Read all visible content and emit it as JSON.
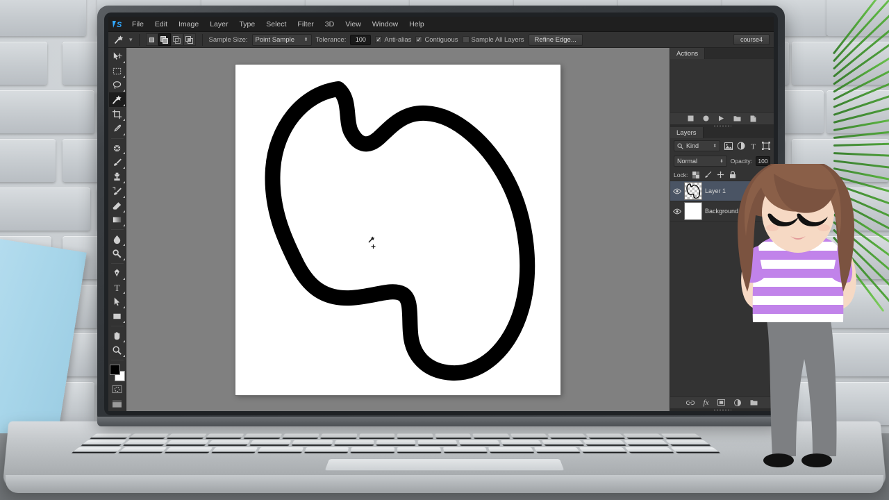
{
  "app": {
    "name": "Adobe Photoshop",
    "logo_text": "PS",
    "logo_color": "#31a8ff"
  },
  "menubar": {
    "items": [
      {
        "label": "File"
      },
      {
        "label": "Edit"
      },
      {
        "label": "Image"
      },
      {
        "label": "Layer"
      },
      {
        "label": "Type"
      },
      {
        "label": "Select"
      },
      {
        "label": "Filter"
      },
      {
        "label": "3D"
      },
      {
        "label": "View"
      },
      {
        "label": "Window"
      },
      {
        "label": "Help"
      }
    ]
  },
  "options_bar": {
    "active_tool": "magic-wand-tool",
    "selection_modes": [
      {
        "name": "new-selection",
        "active": false
      },
      {
        "name": "add-to-selection",
        "active": true
      },
      {
        "name": "subtract-from-selection",
        "active": false
      },
      {
        "name": "intersect-with-selection",
        "active": false
      }
    ],
    "sample_size_label": "Sample Size:",
    "sample_size_value": "Point Sample",
    "tolerance_label": "Tolerance:",
    "tolerance_value": "100",
    "anti_alias_label": "Anti-alias",
    "anti_alias_checked": true,
    "contiguous_label": "Contiguous",
    "contiguous_checked": true,
    "sample_all_layers_label": "Sample All Layers",
    "sample_all_layers_checked": false,
    "refine_edge_label": "Refine Edge...",
    "workspace_label": "course4"
  },
  "toolbar": {
    "tools": [
      {
        "name": "move-tool",
        "selected": false
      },
      {
        "name": "rectangular-marquee-tool",
        "selected": false
      },
      {
        "name": "lasso-tool",
        "selected": false
      },
      {
        "name": "magic-wand-tool",
        "selected": true
      },
      {
        "name": "crop-tool",
        "selected": false
      },
      {
        "name": "eyedropper-tool",
        "selected": false
      },
      {
        "name": "spot-healing-brush-tool",
        "selected": false
      },
      {
        "name": "brush-tool",
        "selected": false
      },
      {
        "name": "clone-stamp-tool",
        "selected": false
      },
      {
        "name": "history-brush-tool",
        "selected": false
      },
      {
        "name": "eraser-tool",
        "selected": false
      },
      {
        "name": "gradient-tool",
        "selected": false
      },
      {
        "name": "blur-tool",
        "selected": false
      },
      {
        "name": "dodge-tool",
        "selected": false
      },
      {
        "name": "pen-tool",
        "selected": false
      },
      {
        "name": "horizontal-type-tool",
        "selected": false
      },
      {
        "name": "path-selection-tool",
        "selected": false
      },
      {
        "name": "rectangle-shape-tool",
        "selected": false
      },
      {
        "name": "hand-tool",
        "selected": false
      },
      {
        "name": "zoom-tool",
        "selected": false
      }
    ],
    "foreground_color": "#000000",
    "background_color": "#ffffff",
    "quick_mask_name": "quick-mask-mode",
    "screen_mode_name": "screen-mode"
  },
  "canvas": {
    "background_color": "#808080",
    "document_color": "#ffffff",
    "artwork_description": "blob-outline-shape",
    "cursor": "magic-wand-cursor",
    "selection_active": true
  },
  "panels": {
    "actions": {
      "tab_label": "Actions",
      "footer_buttons": [
        {
          "name": "stop-button"
        },
        {
          "name": "record-button"
        },
        {
          "name": "play-button"
        },
        {
          "name": "new-set-button"
        },
        {
          "name": "new-action-button"
        }
      ]
    },
    "layers": {
      "tab_label": "Layers",
      "kind_label": "Kind",
      "filter_icons": [
        {
          "name": "filter-pixel-icon"
        },
        {
          "name": "filter-adjustment-icon"
        },
        {
          "name": "filter-type-icon"
        },
        {
          "name": "filter-shape-icon"
        }
      ],
      "blend_mode": "Normal",
      "opacity_label": "Opacity:",
      "opacity_value": "100",
      "lock_label": "Lock:",
      "lock_buttons": [
        {
          "name": "lock-transparent-pixels-icon"
        },
        {
          "name": "lock-image-pixels-icon"
        },
        {
          "name": "lock-position-icon"
        },
        {
          "name": "lock-all-icon"
        }
      ],
      "layers": [
        {
          "name": "Layer 1",
          "visible": true,
          "selected": true,
          "thumb": "transparent"
        },
        {
          "name": "Background",
          "visible": true,
          "selected": false,
          "thumb": "white"
        }
      ],
      "footer_buttons": [
        {
          "name": "link-layers-button"
        },
        {
          "name": "layer-style-button"
        },
        {
          "name": "add-layer-mask-button"
        },
        {
          "name": "adjustment-layer-button"
        },
        {
          "name": "new-group-button"
        }
      ]
    }
  },
  "scene": {
    "wall_color": "#c9ced2",
    "floor_color": "#8e9295",
    "laptop_body_color": "#c3c7ca",
    "blue_board_color": "#b4dcee",
    "plant_color": "#4fae33",
    "character": {
      "name": "cartoon-woman-presenter",
      "hair_color": "#7b5340",
      "skin_color": "#f6d9c4",
      "shirt_color": "#c183ea",
      "shirt_stripe_color": "#ffffff",
      "pants_color": "#7d7f82",
      "shoe_color": "#111111"
    }
  }
}
